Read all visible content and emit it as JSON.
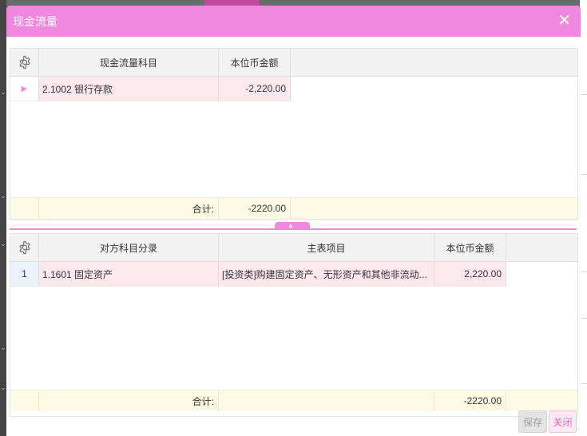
{
  "dialog": {
    "title": "现金流量",
    "close_glyph": "✕"
  },
  "grid1": {
    "columns": [
      "现金流量科目",
      "本位币金额"
    ],
    "rows": [
      {
        "marker": "▶",
        "subject": "2.1002  银行存款",
        "amount": "-2,220.00"
      }
    ],
    "footer": {
      "label": "合计:",
      "amount": "-2220.00"
    }
  },
  "grid2": {
    "columns": [
      "对方科目分录",
      "主表项目",
      "本位币金额"
    ],
    "rows": [
      {
        "index": "1",
        "subject": "1.1601  固定资产",
        "item": "[投资类]购建固定资产、无形资产和其他非流动...",
        "amount": "2,220.00"
      }
    ],
    "footer": {
      "label": "合计:",
      "amount": "-2220.00"
    }
  },
  "buttons": {
    "save": "保存",
    "close": "关闭"
  },
  "icons": {
    "settings": "gear-icon",
    "splitter": "caret-up-icon"
  },
  "colors": {
    "accent": "#f088e0",
    "row_highlight": "#fde8ee",
    "footer": "#fdfbe4"
  }
}
